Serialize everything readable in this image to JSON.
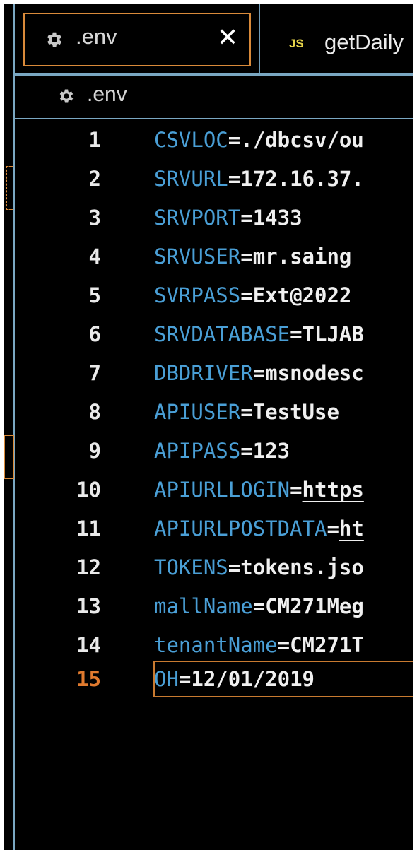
{
  "tabs": [
    {
      "label": ".env",
      "icon": "gear-icon",
      "active": true,
      "close_label": "✕"
    },
    {
      "label": "getDaily",
      "badge": "JS"
    }
  ],
  "breadcrumb": {
    "icon": "gear-icon",
    "label": ".env"
  },
  "editor": {
    "current_line": 15,
    "lines": [
      {
        "num": "1",
        "key": "CSVLOC",
        "eq": "=",
        "value": "./dbcsv/ou"
      },
      {
        "num": "2",
        "key": "SRVURL",
        "eq": "=",
        "value": "172.16.37."
      },
      {
        "num": "3",
        "key": "SRVPORT",
        "eq": "=",
        "value": "1433"
      },
      {
        "num": "4",
        "key": "SRVUSER",
        "eq": "=",
        "value": "mr.saing"
      },
      {
        "num": "5",
        "key": "SVRPASS",
        "eq": "=",
        "value": "Ext@2022"
      },
      {
        "num": "6",
        "key": "SRVDATABASE",
        "eq": "=",
        "value": "TLJAB"
      },
      {
        "num": "7",
        "key": "DBDRIVER",
        "eq": "=",
        "value": "msnodesc"
      },
      {
        "num": "8",
        "key": "APIUSER",
        "eq": "=",
        "value": "TestUse"
      },
      {
        "num": "9",
        "key": "APIPASS",
        "eq": "=",
        "value": "123"
      },
      {
        "num": "10",
        "key": "APIURLLOGIN",
        "eq": "=",
        "value": "https"
      },
      {
        "num": "11",
        "key": "APIURLPOSTDATA",
        "eq": "=",
        "value": "ht"
      },
      {
        "num": "12",
        "key": "TOKENS",
        "eq": "=",
        "value": "tokens.jso"
      },
      {
        "num": "13",
        "key": "mallName",
        "eq": "=",
        "value": "CM271Meg"
      },
      {
        "num": "14",
        "key": "tenantName",
        "eq": "=",
        "value": "CM271T"
      },
      {
        "num": "15",
        "key": "OH",
        "eq": "=",
        "value": "12/01/2019"
      }
    ]
  },
  "colors": {
    "background": "#000000",
    "key": "#4a9fd6",
    "value": "#f0f0f0",
    "current_line_number": "#e07a2e",
    "active_border": "#d98a3a",
    "js_badge": "#e6d34a",
    "divider": "#7aa7c2"
  }
}
